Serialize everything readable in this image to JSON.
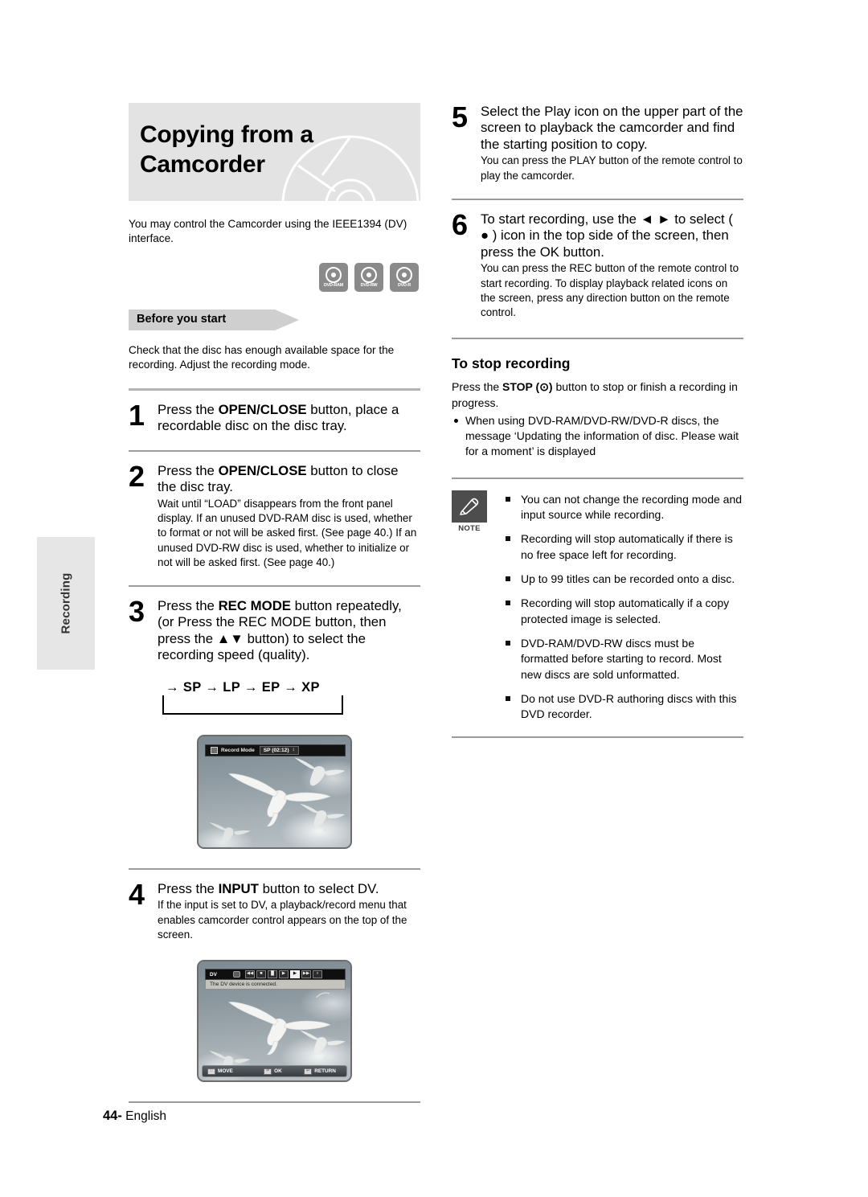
{
  "side_tab": {
    "label": "Recording"
  },
  "header": {
    "title_line1": "Copying from a",
    "title_line2": "Camcorder",
    "disc_art_icon": "dvd-disc-outline-icon"
  },
  "intro": {
    "text": "You may control the Camcorder using the IEEE1394 (DV) interface."
  },
  "disc_badges": [
    {
      "label": "DVD-RAM",
      "icon": "disc-icon"
    },
    {
      "label": "DVD-RW",
      "icon": "disc-icon"
    },
    {
      "label": "DVD-R",
      "icon": "disc-icon"
    }
  ],
  "before_you_start": {
    "heading": "Before you start",
    "body": "Check that the disc has enough available space for the recording. Adjust the recording mode."
  },
  "steps": [
    {
      "number": "1",
      "lead_pre": "Press the ",
      "lead_bold": "OPEN/CLOSE",
      "lead_post": " button, place a recordable disc on the disc tray.",
      "sub": ""
    },
    {
      "number": "2",
      "lead_pre": "Press the ",
      "lead_bold": "OPEN/CLOSE",
      "lead_post": " button to close the disc tray.",
      "sub": "Wait until “LOAD” disappears from the front panel display. If an unused DVD-RAM disc is used, whether to format or not will be asked first. (See page 40.) If an unused DVD-RW disc is used, whether to initialize or not will be asked first. (See page 40.)"
    },
    {
      "number": "3",
      "lead_pre": "Press the ",
      "lead_bold": "REC MODE",
      "lead_post": " button repeatedly, (or Press the REC MODE button, then press the ▲▼ button) to select the recording speed (quality).",
      "sub": ""
    },
    {
      "number": "4",
      "lead_pre": "Press the ",
      "lead_bold": "INPUT",
      "lead_post": " button to select DV.",
      "sub": "If the input is set to DV, a playback/record menu that enables camcorder control appears on the top of the screen."
    },
    {
      "number": "5",
      "lead_pre": "",
      "lead_bold": "",
      "lead_post": "Select the Play icon on the upper part of the screen to playback the camcorder and find the starting position to copy.",
      "sub": "You can press the PLAY button of the remote control to play the camcorder."
    },
    {
      "number": "6",
      "lead_pre": "",
      "lead_bold": "",
      "lead_post": "To start recording, use the ◄ ► to select ( ● ) icon in the top side of the screen, then press the OK button.",
      "sub": "You can press the REC button of the remote control to start recording. To display playback related icons on the screen, press any direction button on the remote control."
    }
  ],
  "step3_extra": {
    "lead_bold2": "REC MODE",
    "cycle": "→ SP → LP → EP → XP"
  },
  "screenshot_rec_mode": {
    "osd_icon": "record-mode-icon",
    "osd_label": "Record Mode",
    "osd_value": "SP (02:12)",
    "osd_spinner": "↕",
    "image_subject": "flying-seagulls-photo"
  },
  "screenshot_dv": {
    "dv_label": "DV",
    "tape_icon": "tape-icon",
    "transport": [
      {
        "icon": "rewind-icon",
        "glyph": "◀◀",
        "selected": false
      },
      {
        "icon": "stop-icon",
        "glyph": "■",
        "selected": false
      },
      {
        "icon": "pause-icon",
        "glyph": "▐▌",
        "selected": false
      },
      {
        "icon": "slow-play-icon",
        "glyph": "▶",
        "selected": false
      },
      {
        "icon": "play-icon",
        "glyph": "▶",
        "selected": true
      },
      {
        "icon": "fast-forward-icon",
        "glyph": "▶▶",
        "selected": false
      },
      {
        "icon": "record-icon",
        "glyph": "●",
        "selected": false
      }
    ],
    "message": "The DV device is connected.",
    "navbar": [
      {
        "key_icon": "dpad-icon",
        "key_glyph": "⬚",
        "label": "MOVE"
      },
      {
        "key_icon": "enter-key-icon",
        "key_glyph": "⬚",
        "label": "OK"
      },
      {
        "key_icon": "return-key-icon",
        "key_glyph": "↶",
        "label": "RETURN"
      }
    ],
    "image_subject": "flying-seagulls-photo"
  },
  "stop_recording": {
    "heading": "To stop recording",
    "line_pre": "Press the ",
    "line_bold": "STOP (⊙)",
    "line_post": " button to stop or finish a recording in progress.",
    "bullets": [
      "When using DVD-RAM/DVD-RW/DVD-R discs, the message ‘Updating the information of disc. Please wait for a moment’ is displayed"
    ]
  },
  "note": {
    "icon": "pencil-icon",
    "caption": "NOTE",
    "items": [
      "You can not change the recording mode and input source while recording.",
      "Recording will stop automatically if there is no free space left for recording.",
      "Up to 99 titles can be recorded onto a disc.",
      "Recording will stop automatically if a copy protected image is selected.",
      "DVD-RAM/DVD-RW discs must be formatted before starting to record. Most new discs are sold unformatted.",
      "Do not use DVD-R authoring discs with this DVD recorder."
    ]
  },
  "footer": {
    "page_number": "44-",
    "language": "English"
  },
  "colors": {
    "header_bg": "#e3e3e3",
    "banner_bg": "#cfcfcf",
    "side_tab_bg": "#e6e6e6",
    "badge_bg": "#8a8a8a",
    "rule": "#b3b3b3",
    "note_icon_bg": "#4d4d4d"
  }
}
